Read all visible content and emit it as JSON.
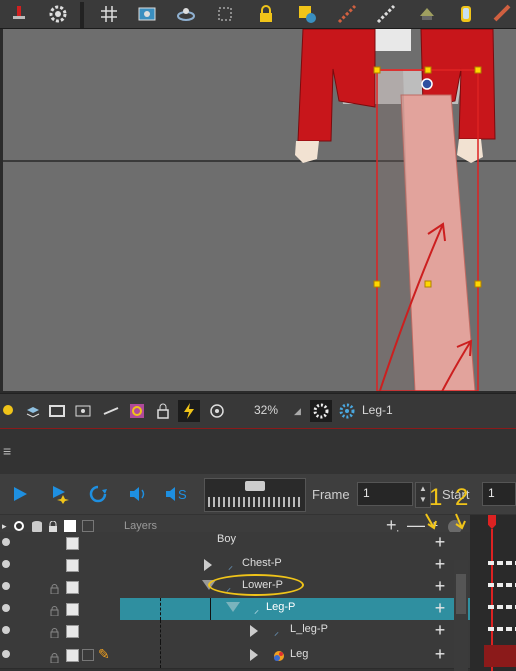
{
  "toolbar": {
    "tools": [
      "pin-icon",
      "gear-icon",
      "grid-icon",
      "camera-frame-icon",
      "rotate-icon",
      "transform-icon",
      "lock-icon",
      "add-element-icon",
      "bone-icon",
      "bone-chain-icon",
      "deform-icon",
      "mirror-icon",
      "ruler-icon"
    ]
  },
  "camera_toolbar": {
    "zoom": "32%",
    "node": "Leg-1"
  },
  "playback": {
    "frame_label": "Frame",
    "frame_value": "1",
    "start_label": "Start",
    "start_value": "1"
  },
  "layer_header": {
    "label": "Layers"
  },
  "layers": [
    {
      "name": "Boy"
    },
    {
      "name": "Chest-P"
    },
    {
      "name": "Lower-P"
    },
    {
      "name": "Leg-P"
    },
    {
      "name": "L_leg-P"
    },
    {
      "name": "Leg"
    }
  ],
  "annotations": {
    "number_1": "1",
    "number_2": "2"
  },
  "colors": {
    "selection": "#2f8fa0",
    "annotation_red": "#cc1f1f",
    "annotation_yellow": "#f0c419",
    "jacket": "#c8161b",
    "leg": "#e2a39c"
  }
}
